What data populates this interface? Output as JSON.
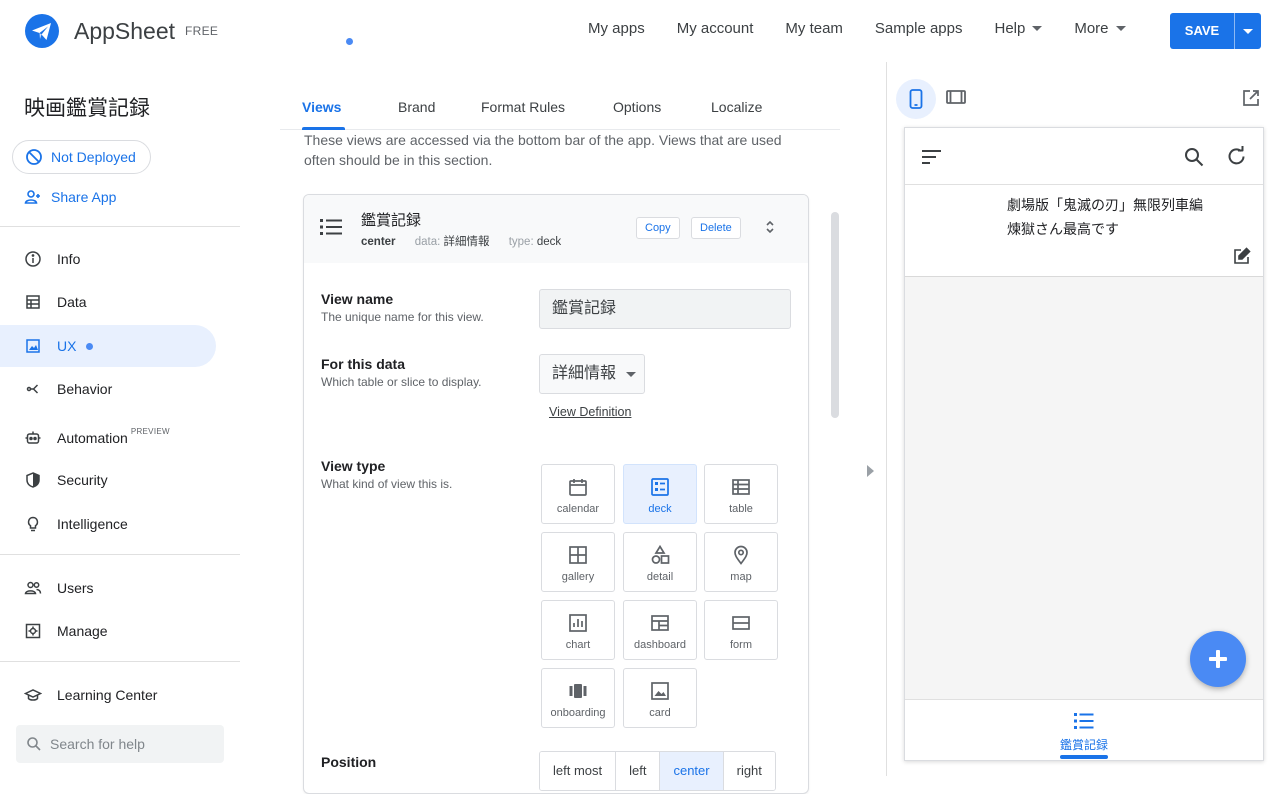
{
  "header": {
    "logo_name": "AppSheet",
    "logo_tier": "FREE",
    "nav": [
      "My apps",
      "My account",
      "My team",
      "Sample apps"
    ],
    "help_label": "Help",
    "more_label": "More",
    "save_label": "SAVE"
  },
  "sidebar": {
    "app_title": "映画鑑賞記録",
    "deploy_status": "Not Deployed",
    "share_label": "Share App",
    "items": {
      "info": "Info",
      "data": "Data",
      "ux": "UX",
      "behavior": "Behavior",
      "automation": "Automation",
      "automation_badge": "PREVIEW",
      "security": "Security",
      "intelligence": "Intelligence",
      "users": "Users",
      "manage": "Manage",
      "learning": "Learning Center"
    },
    "search_placeholder": "Search for help"
  },
  "editor": {
    "tabs": [
      "Views",
      "Brand",
      "Format Rules",
      "Options",
      "Localize"
    ],
    "description": "These views are accessed via the bottom bar of the app. Views that are used often should be in this section.",
    "view": {
      "title": "鑑賞記録",
      "position": "center",
      "data_key": "data:",
      "data_value": "詳細情報",
      "type_key": "type:",
      "type_value": "deck",
      "copy_label": "Copy",
      "delete_label": "Delete"
    },
    "view_name": {
      "label": "View name",
      "sub": "The unique name for this view.",
      "value": "鑑賞記録"
    },
    "for_data": {
      "label": "For this data",
      "sub": "Which table or slice to display.",
      "value": "詳細情報",
      "link": "View Definition"
    },
    "view_type": {
      "label": "View type",
      "sub": "What kind of view this is.",
      "options": [
        "calendar",
        "deck",
        "table",
        "gallery",
        "detail",
        "map",
        "chart",
        "dashboard",
        "form",
        "onboarding",
        "card"
      ],
      "selected": "deck"
    },
    "position": {
      "label": "Position",
      "options": [
        "left most",
        "left",
        "center",
        "right"
      ],
      "selected": "center"
    }
  },
  "preview": {
    "deck_line1": "劇場版「鬼滅の刃」無限列車編",
    "deck_line2": "煉獄さん最高です",
    "bottom_nav_label": "鑑賞記録"
  }
}
